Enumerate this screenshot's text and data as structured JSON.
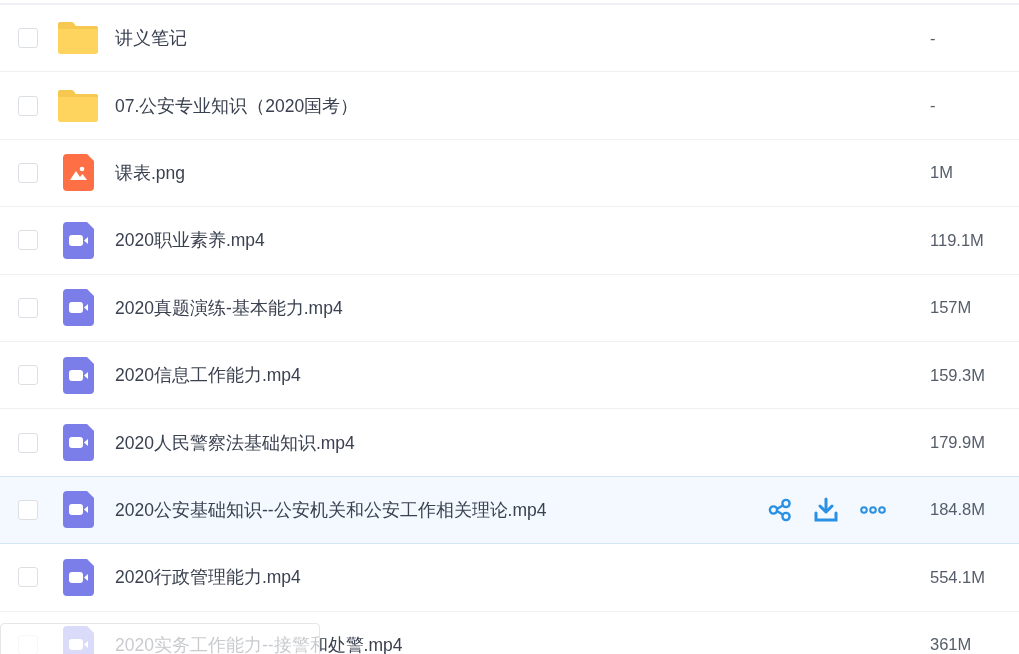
{
  "files": [
    {
      "kind": "folder",
      "name": "讲义笔记",
      "size": "-",
      "checked": false,
      "hovered": false
    },
    {
      "kind": "folder",
      "name": "07.公安专业知识（2020国考）",
      "size": "-",
      "checked": false,
      "hovered": false
    },
    {
      "kind": "image",
      "name": "课表.png",
      "size": "1M",
      "checked": false,
      "hovered": false
    },
    {
      "kind": "video",
      "name": "2020职业素养.mp4",
      "size": "119.1M",
      "checked": false,
      "hovered": false
    },
    {
      "kind": "video",
      "name": "2020真题演练-基本能力.mp4",
      "size": "157M",
      "checked": false,
      "hovered": false
    },
    {
      "kind": "video",
      "name": "2020信息工作能力.mp4",
      "size": "159.3M",
      "checked": false,
      "hovered": false
    },
    {
      "kind": "video",
      "name": "2020人民警察法基础知识.mp4",
      "size": "179.9M",
      "checked": false,
      "hovered": false
    },
    {
      "kind": "video",
      "name": "2020公安基础知识--公安机关和公安工作相关理论.mp4",
      "size": "184.8M",
      "checked": false,
      "hovered": true
    },
    {
      "kind": "video",
      "name": "2020行政管理能力.mp4",
      "size": "554.1M",
      "checked": false,
      "hovered": false
    },
    {
      "kind": "video",
      "name": "2020实务工作能力--接警和处警.mp4",
      "size": "361M",
      "checked": false,
      "hovered": false
    }
  ]
}
